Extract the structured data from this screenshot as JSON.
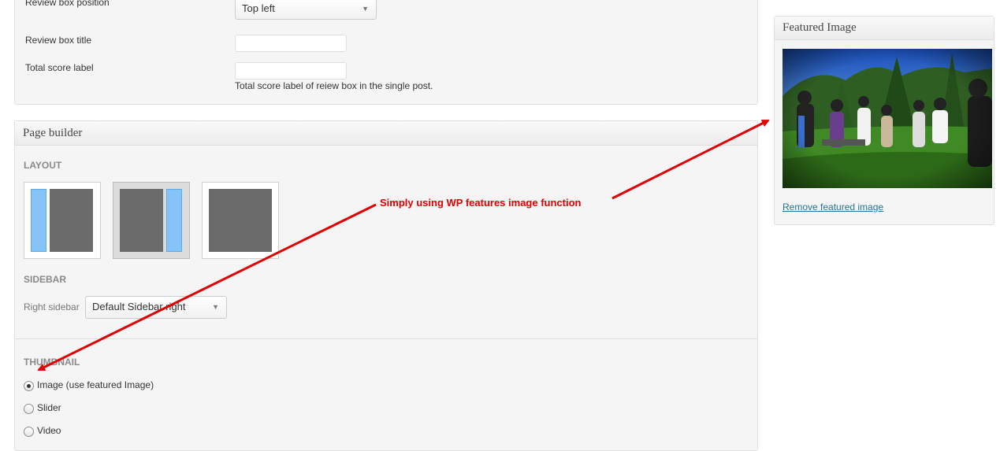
{
  "review": {
    "position_label": "Review box position",
    "position_value": "Top left",
    "title_label": "Review box title",
    "title_value": "",
    "score_label": "Total score label",
    "score_value": "",
    "score_help": "Total score label of reiew box in the single post."
  },
  "page_builder": {
    "title": "Page builder",
    "layout_heading": "LAYOUT",
    "layout_options": [
      {
        "name": "sidebar-left",
        "selected": false
      },
      {
        "name": "sidebar-right",
        "selected": true
      },
      {
        "name": "full-width",
        "selected": false
      }
    ],
    "sidebar_heading": "SIDEBAR",
    "right_sidebar_label": "Right sidebar",
    "right_sidebar_value": "Default Sidebar right",
    "thumbnail_heading": "THUMBNAIL",
    "thumbnail_options": [
      {
        "label": "Image (use featured Image)",
        "checked": true
      },
      {
        "label": "Slider",
        "checked": false
      },
      {
        "label": "Video",
        "checked": false
      }
    ]
  },
  "featured_image": {
    "title": "Featured Image",
    "remove_link": "Remove featured image",
    "photo_icon": "band-outdoor-photo"
  },
  "annotation": {
    "text": "Simply using WP features image function",
    "color": "#e00000"
  },
  "colors": {
    "link": "#21759b",
    "layout_sidebar": "#86c3f7",
    "layout_main": "#6b6b6b"
  }
}
